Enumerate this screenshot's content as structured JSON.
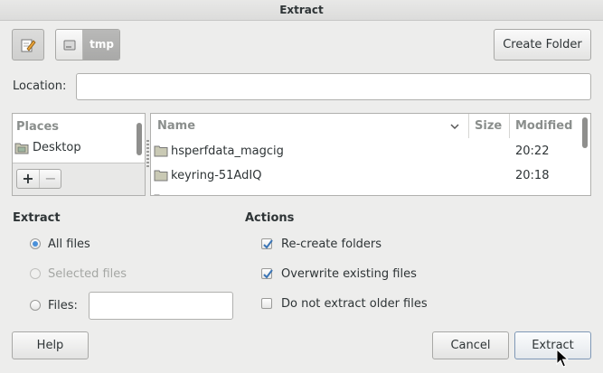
{
  "window": {
    "title": "Extract"
  },
  "path_bar": {
    "current_folder": "tmp",
    "edit_icon": "edit-pencil-icon",
    "drive_icon": "drive-icon"
  },
  "toolbar": {
    "create_folder_label": "Create Folder"
  },
  "location": {
    "label": "Location:",
    "value": "",
    "placeholder": ""
  },
  "places": {
    "header": "Places",
    "items": [
      {
        "label": "Desktop",
        "icon": "desktop-folder-icon"
      }
    ],
    "add_label": "+",
    "remove_label": "−"
  },
  "files": {
    "columns": {
      "name": "Name",
      "size": "Size",
      "modified": "Modified"
    },
    "rows": [
      {
        "name": "hsperfdata_magcig",
        "size": "",
        "modified": "20:22",
        "icon": "folder-icon"
      },
      {
        "name": "keyring-51AdIQ",
        "size": "",
        "modified": "20:18",
        "icon": "folder-icon"
      }
    ]
  },
  "extract": {
    "title": "Extract",
    "all_files": "All files",
    "selected_files": "Selected files",
    "files_label": "Files:",
    "files_value": ""
  },
  "actions": {
    "title": "Actions",
    "recreate_folders": "Re-create folders",
    "overwrite_existing": "Overwrite existing files",
    "do_not_extract_older": "Do not extract older files"
  },
  "buttons": {
    "help": "Help",
    "cancel": "Cancel",
    "extract": "Extract"
  },
  "colors": {
    "accent": "#4a90d9",
    "window_bg": "#ededec"
  }
}
